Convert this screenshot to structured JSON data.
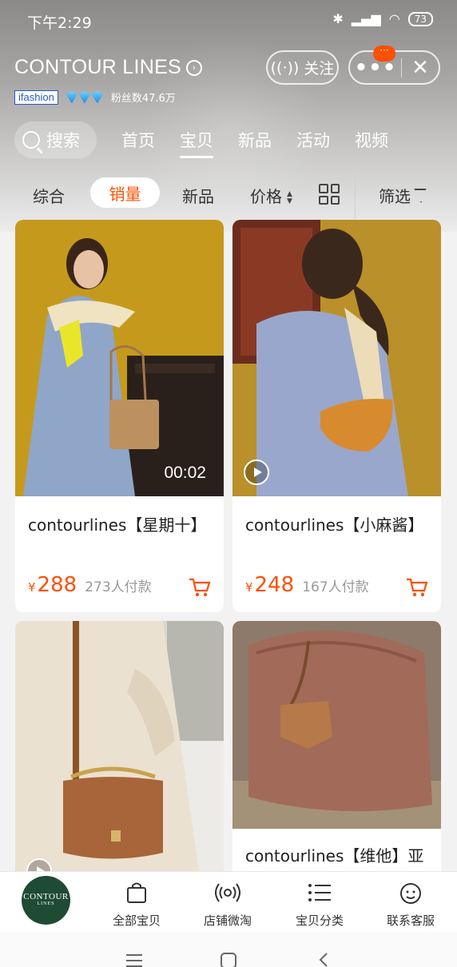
{
  "status": {
    "time": "下午2:29",
    "battery": "73"
  },
  "shop": {
    "name": "CONTOUR LINES",
    "ifashion": "ifashion",
    "fans": "粉丝数47.6万",
    "follow_label": "关注",
    "more_badge": "···"
  },
  "nav_tabs": {
    "search": "搜索",
    "items": [
      "首页",
      "宝贝",
      "新品",
      "活动",
      "视频"
    ],
    "active": "宝贝"
  },
  "sort_bar": {
    "items": [
      "综合",
      "销量",
      "新品",
      "价格"
    ],
    "active": "销量",
    "filter": "筛选"
  },
  "products": [
    {
      "title": "contourlines【星期十】",
      "currency": "¥",
      "price": "288",
      "paid": "273人付款",
      "duration": "00:02"
    },
    {
      "title": "contourlines【小麻酱】",
      "currency": "¥",
      "price": "248",
      "paid": "167人付款"
    },
    {
      "title": ""
    },
    {
      "title": "contourlines【维他】亚"
    }
  ],
  "bottom_nav": {
    "logo_line1": "CONTOUR",
    "logo_line2": "LINES",
    "items": [
      "全部宝贝",
      "店铺微淘",
      "宝贝分类",
      "联系客服"
    ]
  },
  "colors": {
    "accent": "#ff5000",
    "logo_bg": "#1f4a34"
  }
}
